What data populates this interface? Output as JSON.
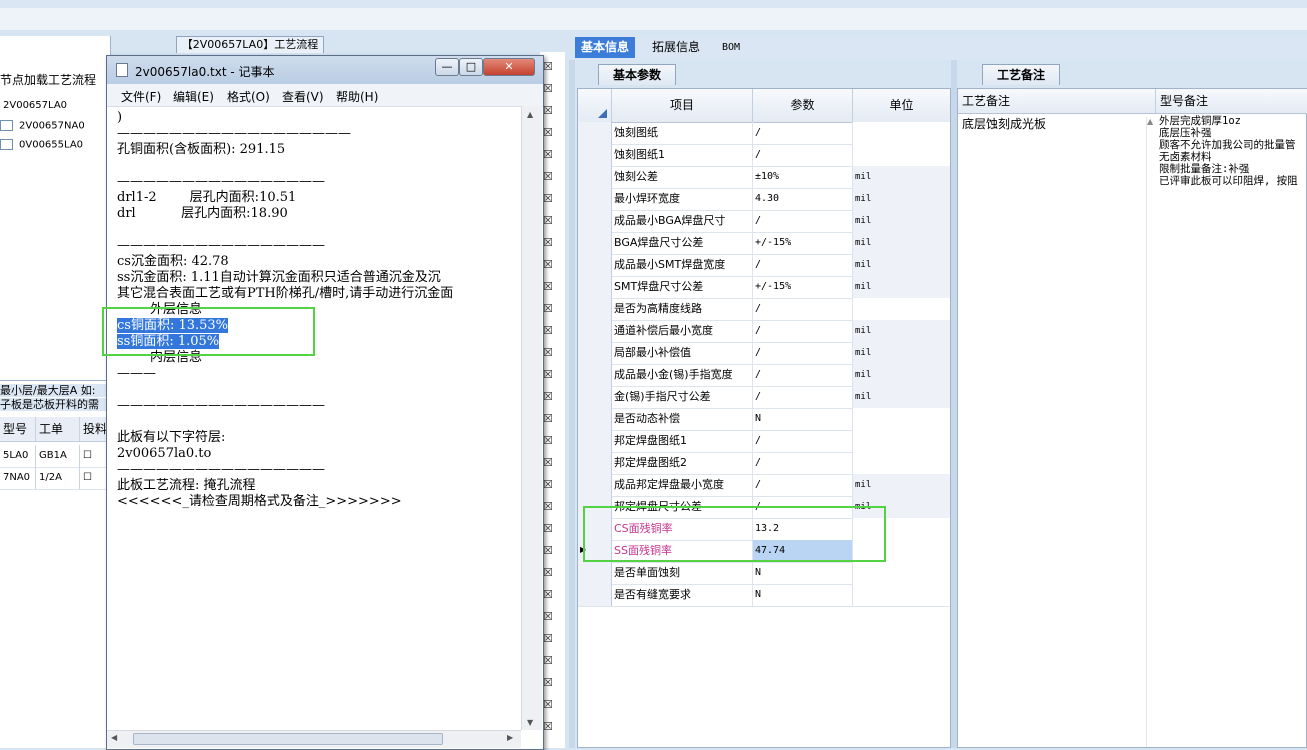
{
  "left_panel": {
    "title": "节点加载工艺流程",
    "tree_root": "2V00657LA0",
    "tree_items": [
      "2V00657NA0",
      "0V00655LA0"
    ],
    "info_line1": "最小层/最大层A 如:",
    "info_line2": "子板是芯板开料的需",
    "grid_headers": [
      "型号",
      "工单",
      "投料"
    ],
    "grid_rows": [
      {
        "model": "5LA0",
        "order": "GB1A"
      },
      {
        "model": "7NA0",
        "order": "1/2A"
      }
    ]
  },
  "middle": {
    "tab_title": "【2V00657LA0】工艺流程"
  },
  "notepad": {
    "title": "2v00657la0.txt - 记事本",
    "menu": [
      "文件(F)",
      "编辑(E)",
      "格式(O)",
      "查看(V)",
      "帮助(H)"
    ],
    "lines": [
      ")",
      "——————————————————",
      "孔铜面积(含板面积): 291.15",
      "",
      "————————————————",
      "drl1-2        层孔内面积:10.51",
      "drl           层孔内面积:18.90",
      "",
      "————————————————",
      "cs沉金面积: 42.78",
      "ss沉金面积: 1.11自动计算沉金面积只适合普通沉金及沉",
      "其它混合表面工艺或有PTH阶梯孔/槽时,请手动进行沉金面",
      "        外层信息",
      "cs铜面积: 13.53%",
      "ss铜面积: 1.05%",
      "        内层信息",
      "———",
      "",
      "————————————————",
      "",
      "此板有以下字符层:",
      "2v00657la0.to",
      "————————————————",
      "此板工艺流程: 掩孔流程",
      "<<<<<<_请检查周期格式及备注_>>>>>>>"
    ]
  },
  "right_panel": {
    "tabs": [
      "基本信息",
      "拓展信息",
      "BOM"
    ],
    "subtab_left": "基本参数",
    "subtab_right": "工艺备注",
    "grid_headers": {
      "item": "项目",
      "param": "参数",
      "unit": "单位"
    },
    "rows": [
      {
        "item": "蚀刻图纸",
        "param": "/",
        "unit": ""
      },
      {
        "item": "蚀刻图纸1",
        "param": "/",
        "unit": ""
      },
      {
        "item": "蚀刻公差",
        "param": "±10%",
        "unit": "mil"
      },
      {
        "item": "最小焊环宽度",
        "param": "4.30",
        "unit": "mil"
      },
      {
        "item": "成品最小BGA焊盘尺寸",
        "param": "/",
        "unit": "mil"
      },
      {
        "item": "BGA焊盘尺寸公差",
        "param": "+/-15%",
        "unit": "mil"
      },
      {
        "item": "成品最小SMT焊盘宽度",
        "param": "/",
        "unit": "mil"
      },
      {
        "item": "SMT焊盘尺寸公差",
        "param": "+/-15%",
        "unit": "mil"
      },
      {
        "item": "是否为高精度线路",
        "param": "/",
        "unit": ""
      },
      {
        "item": "通道补偿后最小宽度",
        "param": "/",
        "unit": "mil"
      },
      {
        "item": "局部最小补偿值",
        "param": "/",
        "unit": "mil"
      },
      {
        "item": "成品最小金(锡)手指宽度",
        "param": "/",
        "unit": "mil"
      },
      {
        "item": "金(锡)手指尺寸公差",
        "param": "/",
        "unit": "mil"
      },
      {
        "item": "是否动态补偿",
        "param": "N",
        "unit": ""
      },
      {
        "item": "邦定焊盘图纸1",
        "param": "/",
        "unit": ""
      },
      {
        "item": "邦定焊盘图纸2",
        "param": "/",
        "unit": ""
      },
      {
        "item": "成品邦定焊盘最小宽度",
        "param": "/",
        "unit": "mil"
      },
      {
        "item": "邦定焊盘尺寸公差",
        "param": "/",
        "unit": "mil"
      },
      {
        "item": "CS面残铜率",
        "param": "13.2",
        "unit": ""
      },
      {
        "item": "SS面残铜率",
        "param": "47.74",
        "unit": ""
      },
      {
        "item": "是否单面蚀刻",
        "param": "N",
        "unit": ""
      },
      {
        "item": "是否有缝宽要求",
        "param": "N",
        "unit": ""
      }
    ],
    "notes_headers": {
      "process": "工艺备注",
      "model": "型号备注"
    },
    "process_note": "底层蚀刻成光板",
    "model_notes": [
      "外层完成铜厚1oz",
      "底层压补强",
      "顾客不允许加我公司的批量管",
      "无卤素材料",
      "限制批量备注:补强",
      "已评审此板可以印阻焊, 按阻"
    ]
  }
}
